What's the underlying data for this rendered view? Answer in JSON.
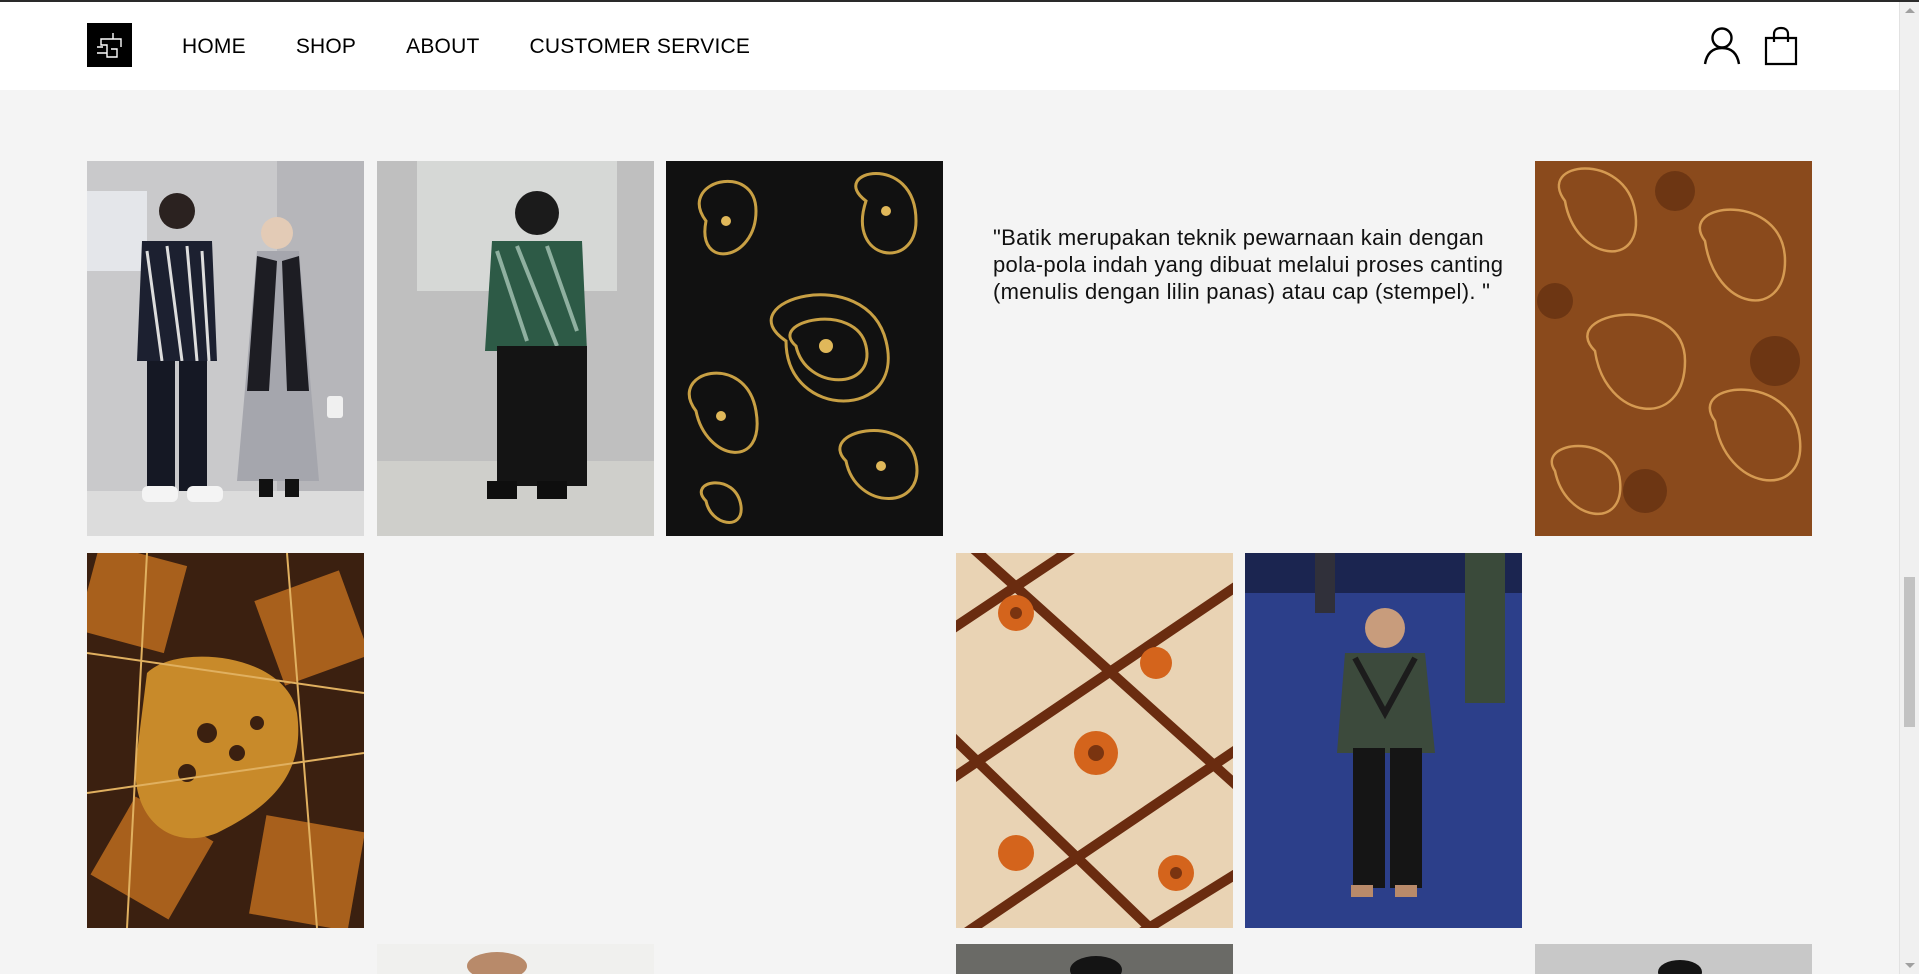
{
  "nav": {
    "items": [
      "HOME",
      "SHOP",
      "ABOUT",
      "CUSTOMER SERVICE"
    ]
  },
  "icons": {
    "logo": "brand-logo",
    "account": "user-icon",
    "cart": "shopping-bag-icon"
  },
  "quote": {
    "text": "\"Batik merupakan teknik pewarnaan kain dengan pola-pola indah yang dibuat melalui proses canting (menulis dengan lilin panas) atau cap (stempel). \""
  },
  "gallery": [
    {
      "name": "photo-couple-batik",
      "type": "photo"
    },
    {
      "name": "photo-man-green-batik",
      "type": "photo"
    },
    {
      "name": "pattern-black-gold-paisley",
      "type": "pattern"
    },
    {
      "name": "pattern-brown-paisley",
      "type": "pattern"
    },
    {
      "name": "pattern-brown-batik-kawung",
      "type": "pattern"
    },
    {
      "name": "pattern-orange-batik-geometric",
      "type": "pattern"
    },
    {
      "name": "photo-runway-model",
      "type": "photo"
    }
  ],
  "colors": {
    "header_bg": "#ffffff",
    "page_bg": "#f4f4f4",
    "text": "#000000"
  }
}
